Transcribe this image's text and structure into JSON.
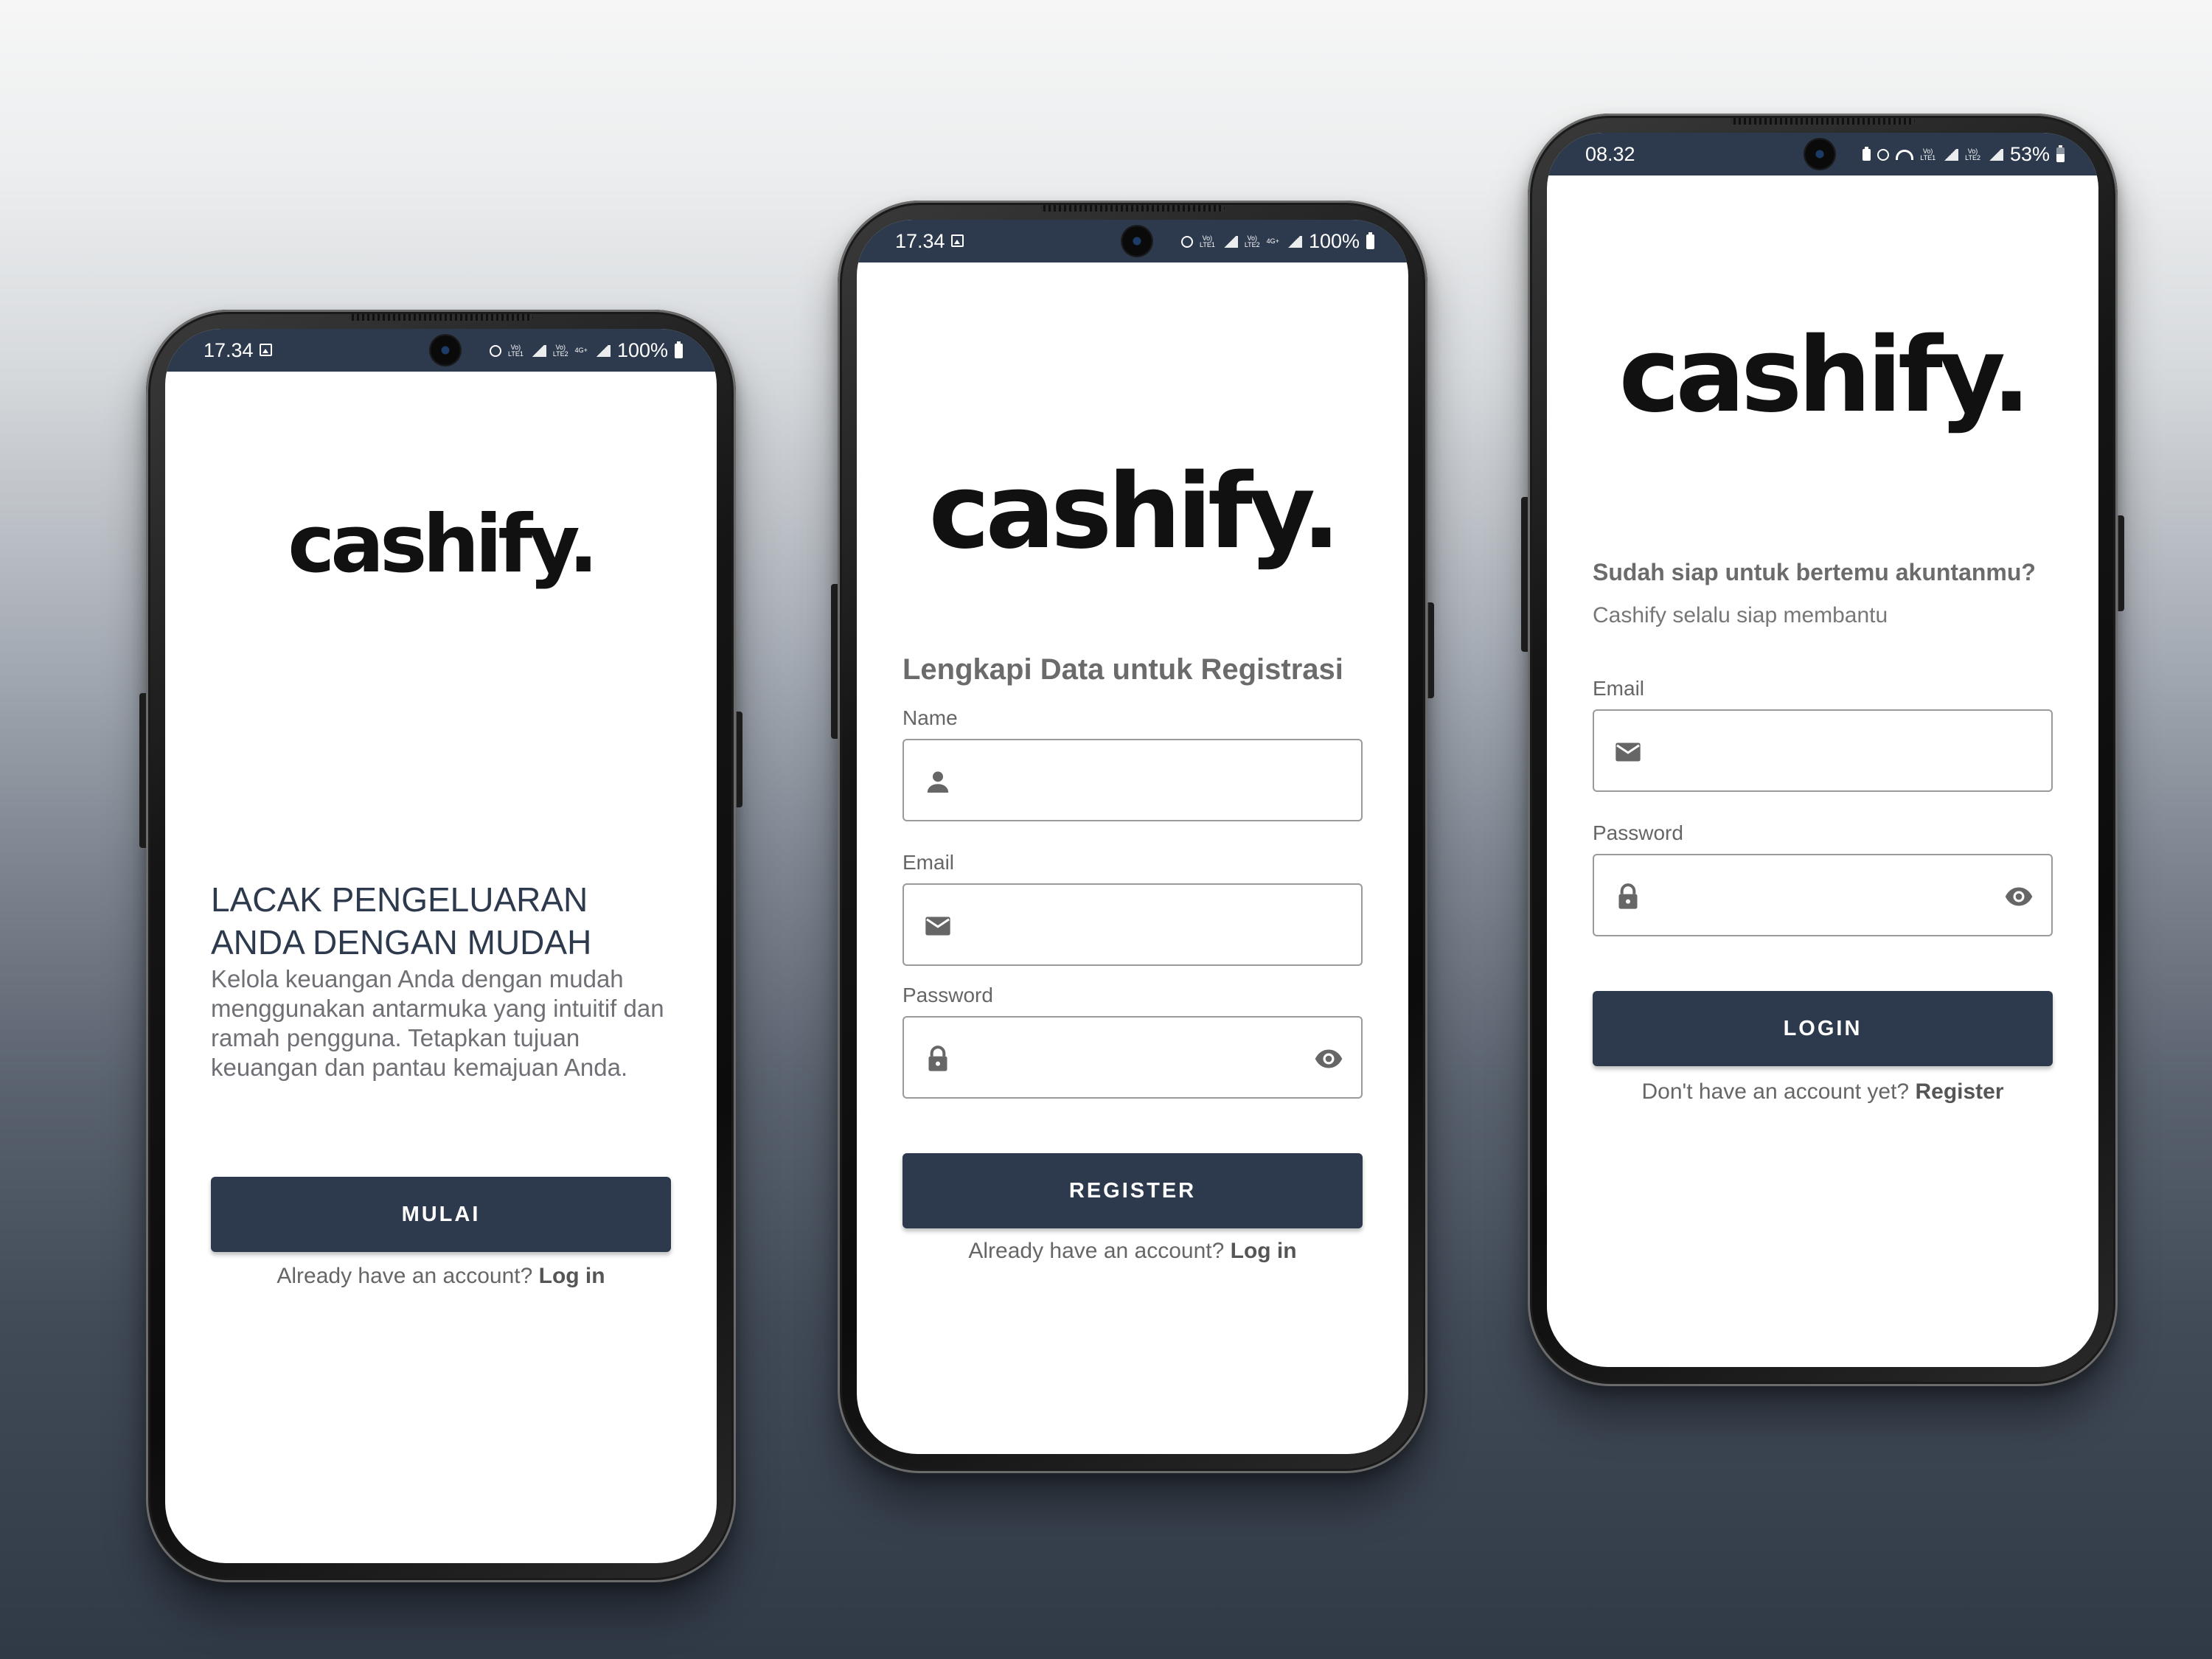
{
  "phones": [
    {
      "status": {
        "time": "17.34",
        "lte1": "Vo)\nLTE1",
        "lte2": "Vo)\nLTE2",
        "net": "4G+",
        "battery": "100%"
      },
      "logo": "cashify.",
      "headline_line1": "LACAK PENGELUARAN",
      "headline_line2": "ANDA DENGAN MUDAH",
      "description": "Kelola keuangan Anda dengan mudah menggunakan antarmuka yang intuitif dan ramah pengguna. Tetapkan tujuan keuangan dan pantau kemajuan Anda.",
      "button": "MULAI",
      "footer_text": "Already have an account? ",
      "footer_link": "Log in"
    },
    {
      "status": {
        "time": "17.34",
        "lte1": "Vo)\nLTE1",
        "lte2": "Vo)\nLTE2",
        "net": "4G+",
        "battery": "100%"
      },
      "logo": "cashify.",
      "title": "Lengkapi Data untuk Registrasi",
      "name_label": "Name",
      "email_label": "Email",
      "password_label": "Password",
      "button": "REGISTER",
      "footer_text": "Already have an account? ",
      "footer_link": "Log in"
    },
    {
      "status": {
        "time": "08.32",
        "lte1": "Vo)\nLTE1",
        "lte2": "Vo)\nLTE2",
        "battery": "53%"
      },
      "logo": "cashify.",
      "title": "Sudah siap untuk bertemu akuntanmu?",
      "subtitle": "Cashify selalu siap membantu",
      "email_label": "Email",
      "password_label": "Password",
      "button": "LOGIN",
      "footer_text": "Don't have an account yet? ",
      "footer_link": "Register"
    }
  ],
  "icons": [
    "image-icon",
    "camera-icon",
    "alarm-icon",
    "signal-icon",
    "battery-icon",
    "wifi-icon",
    "person-icon",
    "mail-icon",
    "lock-icon",
    "eye-icon"
  ],
  "colors": {
    "primary": "#2d3a4d",
    "background_top": "#f6f6f6",
    "background_bottom": "#303946",
    "text_muted": "#6e7075"
  }
}
